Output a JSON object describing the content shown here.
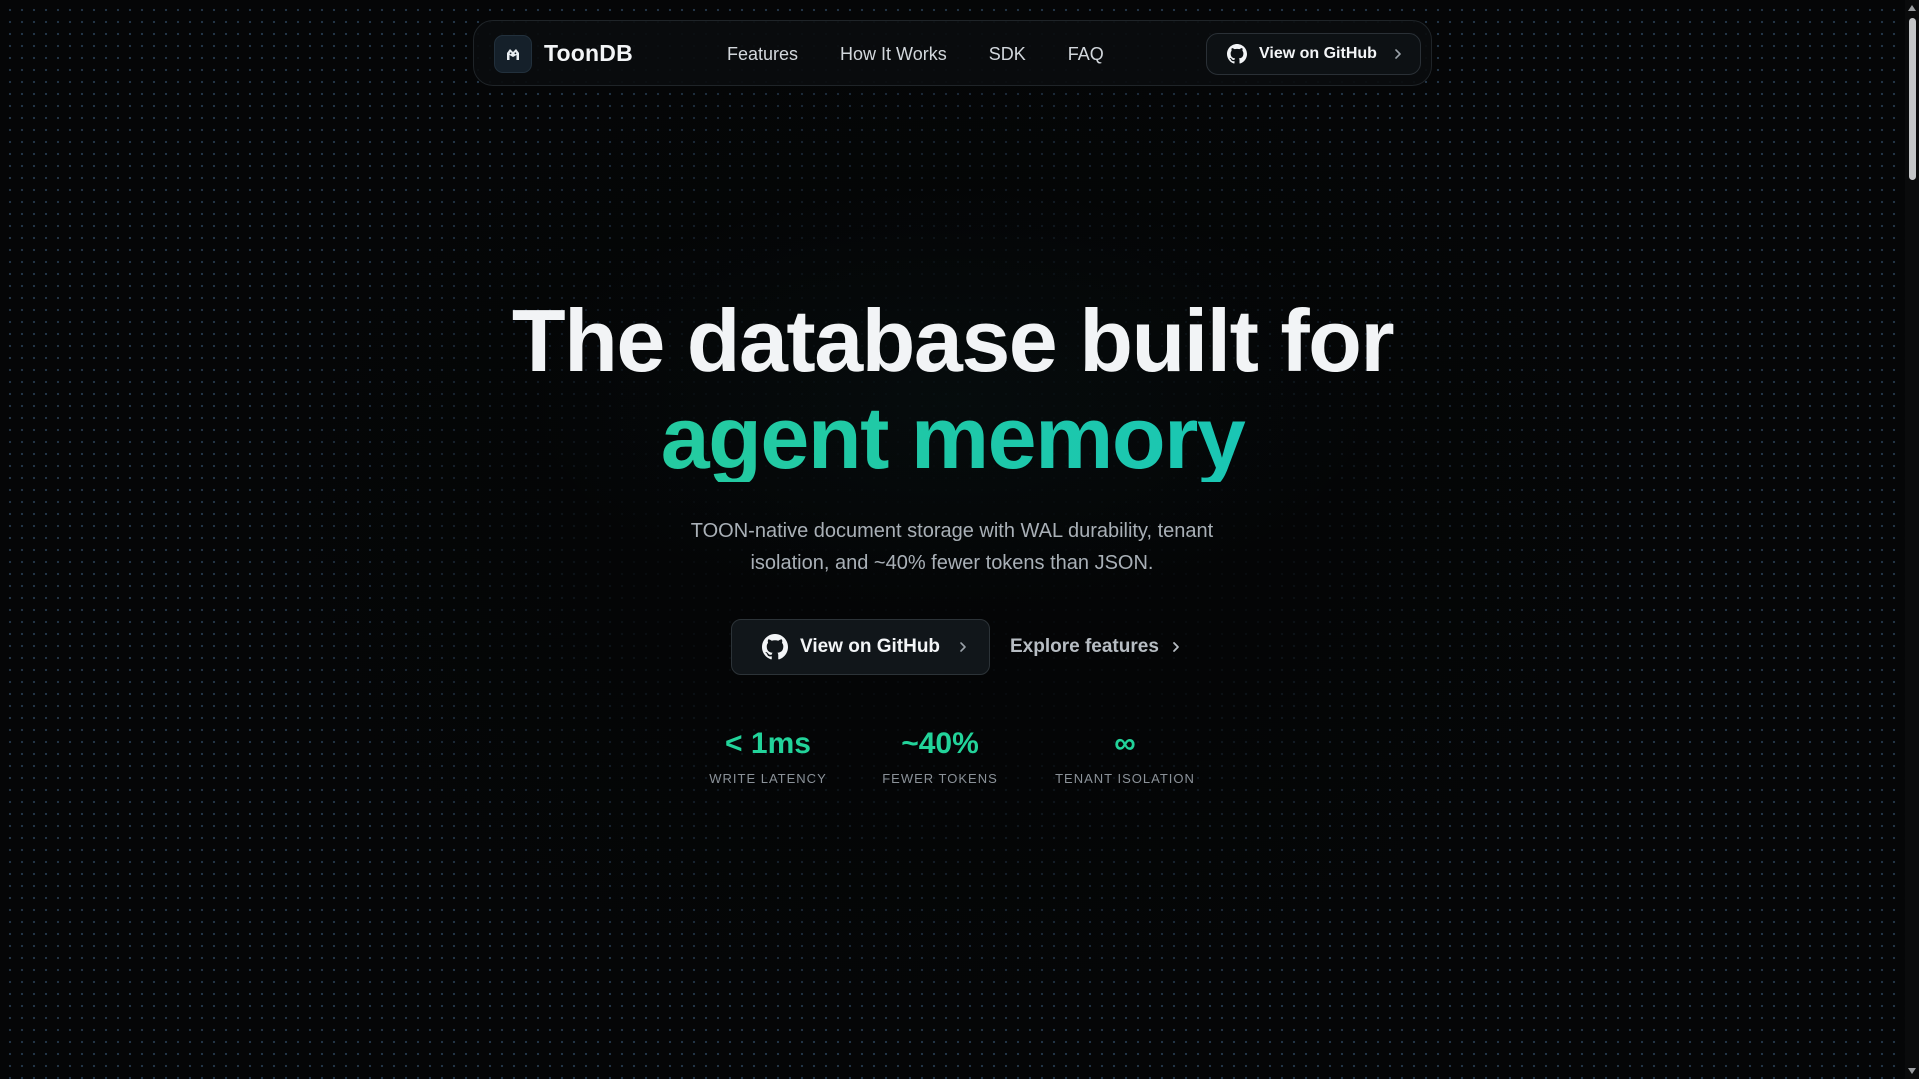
{
  "nav": {
    "brand": "ToonDB",
    "links": [
      "Features",
      "How It Works",
      "SDK",
      "FAQ"
    ],
    "github_label": "View on GitHub"
  },
  "hero": {
    "headline_line1": "The database built for",
    "headline_line2": "agent memory",
    "subtitle": "TOON-native document storage with WAL durability, tenant isolation, and ~40% fewer tokens than JSON.",
    "primary_cta": "View on GitHub",
    "secondary_cta": "Explore features",
    "gradient_colors": [
      "#34d38f",
      "#12c3cf"
    ]
  },
  "stats": [
    {
      "value": "< 1ms",
      "label": "WRITE LATENCY"
    },
    {
      "value": "~40%",
      "label": "FEWER TOKENS"
    },
    {
      "value": "∞",
      "label": "TENANT ISOLATION"
    }
  ],
  "icons": {
    "logo": "toon-logo-icon",
    "github": "github-icon",
    "chevron": "chevron-right-icon"
  },
  "colors": {
    "background": "#050607",
    "accent": "#22d39a"
  }
}
